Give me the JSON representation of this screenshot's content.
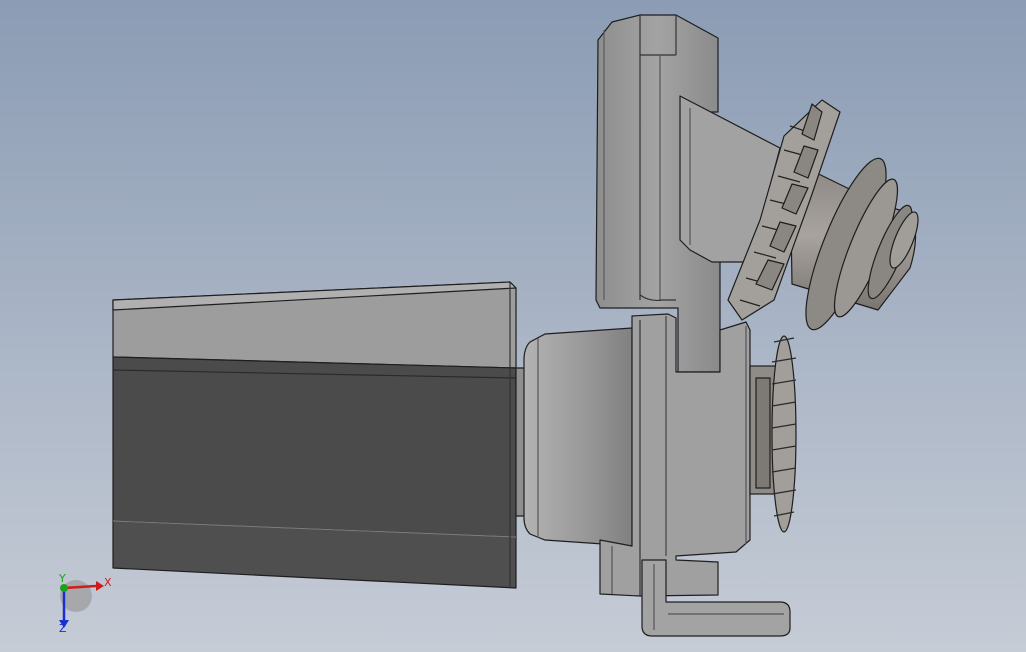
{
  "viewport": {
    "background_top": "#8c9db5",
    "background_bottom": "#c4cad4",
    "part_color": "#9c9c9c",
    "part_dark": "#4a4a4a",
    "edge_color": "#222222"
  },
  "triad": {
    "x_label": "X",
    "y_label": "Y",
    "z_label": "Z",
    "x_color": "#d11a1a",
    "y_color": "#19a319",
    "z_color": "#1a2fd1"
  }
}
